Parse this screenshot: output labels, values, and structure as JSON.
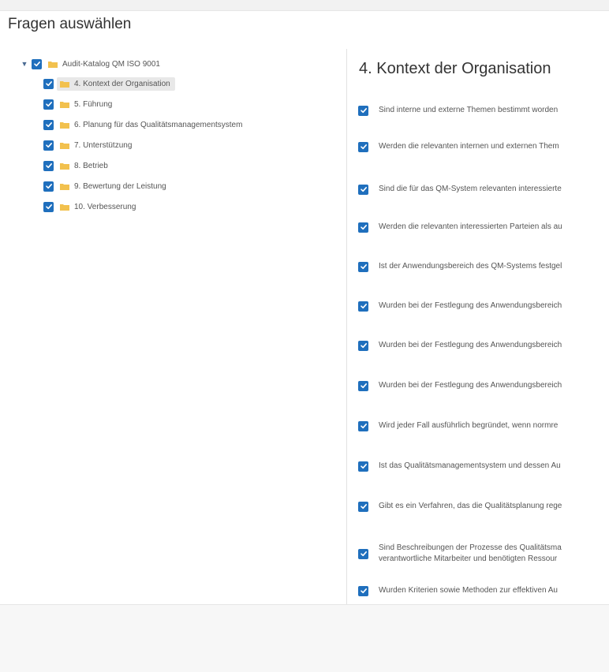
{
  "dialog": {
    "title": "Fragen auswählen"
  },
  "tree": {
    "root": {
      "label": "Audit-Katalog QM ISO 9001",
      "checked": true,
      "expanded": true
    },
    "children": [
      {
        "label": "4. Kontext der Organisation",
        "checked": true,
        "selected": true
      },
      {
        "label": "5. Führung",
        "checked": true
      },
      {
        "label": "6. Planung für das Qualitätsmanagementsystem",
        "checked": true
      },
      {
        "label": "7. Unterstützung",
        "checked": true
      },
      {
        "label": "8. Betrieb",
        "checked": true
      },
      {
        "label": "9. Bewertung der Leistung",
        "checked": true
      },
      {
        "label": "10. Verbesserung",
        "checked": true
      }
    ]
  },
  "detail": {
    "title": "4. Kontext der Organisation",
    "questions": [
      {
        "text": "Sind interne und externe Themen bestimmt worden",
        "checked": true
      },
      {
        "text": "Werden die relevanten internen und externen Them",
        "checked": true
      },
      {
        "text": "Sind die für das QM-System relevanten interessierte",
        "checked": true
      },
      {
        "text": "Werden die relevanten interessierten Parteien als au",
        "checked": true
      },
      {
        "text": "Ist der Anwendungsbereich des QM-Systems festgel",
        "checked": true
      },
      {
        "text": "Wurden bei der Festlegung des Anwendungsbereich",
        "checked": true
      },
      {
        "text": "Wurden bei der Festlegung des Anwendungsbereich",
        "checked": true
      },
      {
        "text": "Wurden bei der Festlegung des Anwendungsbereich",
        "checked": true
      },
      {
        "text": "Wird jeder Fall ausführlich begründet, wenn normre",
        "checked": true
      },
      {
        "text": "Ist das Qualitätsmanagementsystem und dessen Au",
        "checked": true
      },
      {
        "text": "Gibt es ein Verfahren, das die Qualitätsplanung rege",
        "checked": true
      },
      {
        "text": "Sind Beschreibungen der Prozesse des Qualitätsma",
        "text2": "verantwortliche Mitarbeiter und benötigten Ressour",
        "checked": true
      },
      {
        "text": "Wurden Kriterien sowie Methoden zur effektiven Au",
        "checked": true
      }
    ]
  },
  "colors": {
    "accent": "#1f6fbd",
    "folder": "#f2c14e",
    "selected_bg": "#e8e8e8"
  },
  "icons": {
    "checkbox": "checkbox-checked-icon",
    "folder": "folder-icon",
    "caret": "caret-down-icon"
  }
}
